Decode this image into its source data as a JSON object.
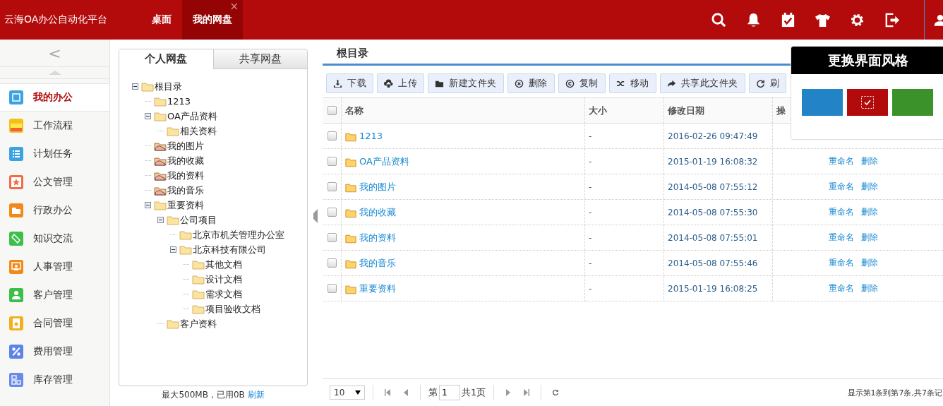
{
  "header": {
    "title": "云海OA办公自动化平台",
    "tabs": [
      {
        "label": "桌面",
        "selected": false
      },
      {
        "label": "我的网盘",
        "selected": true,
        "close": "×"
      }
    ]
  },
  "sidebar": {
    "collapse": "<",
    "items": [
      {
        "label": "我的办公",
        "selected": true,
        "color": "#3aa3e3"
      },
      {
        "label": "工作流程",
        "selected": false,
        "color": "#f2c21a"
      },
      {
        "label": "计划任务",
        "selected": false,
        "color": "#3aa3e3"
      },
      {
        "label": "公文管理",
        "selected": false,
        "color": "#f26b4a"
      },
      {
        "label": "行政办公",
        "selected": false,
        "color": "#f28a1a"
      },
      {
        "label": "知识交流",
        "selected": false,
        "color": "#3cbf4a"
      },
      {
        "label": "人事管理",
        "selected": false,
        "color": "#f28a1a"
      },
      {
        "label": "客户管理",
        "selected": false,
        "color": "#3cbf4a"
      },
      {
        "label": "合同管理",
        "selected": false,
        "color": "#f2b01a"
      },
      {
        "label": "费用管理",
        "selected": false,
        "color": "#5b84e8"
      },
      {
        "label": "库存管理",
        "selected": false,
        "color": "#6a8ae8"
      }
    ]
  },
  "disk_tabs": [
    {
      "label": "个人网盘",
      "selected": true
    },
    {
      "label": "共享网盘",
      "selected": false
    }
  ],
  "tree": [
    {
      "label": "根目录",
      "kind": "folder",
      "expanded": true,
      "children": [
        {
          "label": "1213",
          "kind": "folder"
        },
        {
          "label": "OA产品资料",
          "kind": "folder",
          "expanded": true,
          "children": [
            {
              "label": "相关资料",
              "kind": "folder"
            }
          ]
        },
        {
          "label": "我的图片",
          "kind": "shared"
        },
        {
          "label": "我的收藏",
          "kind": "shared"
        },
        {
          "label": "我的资料",
          "kind": "shared"
        },
        {
          "label": "我的音乐",
          "kind": "shared"
        },
        {
          "label": "重要资料",
          "kind": "folder",
          "expanded": true,
          "children": [
            {
              "label": "公司项目",
              "kind": "folder",
              "expanded": true,
              "children": [
                {
                  "label": "北京市机关管理办公室",
                  "kind": "folder"
                },
                {
                  "label": "北京科技有限公司",
                  "kind": "folder",
                  "expanded": true,
                  "children": [
                    {
                      "label": "其他文档",
                      "kind": "folder"
                    },
                    {
                      "label": "设计文档",
                      "kind": "folder"
                    },
                    {
                      "label": "需求文档",
                      "kind": "folder"
                    },
                    {
                      "label": "项目验收文档",
                      "kind": "folder"
                    }
                  ]
                }
              ]
            },
            {
              "label": "客户资料",
              "kind": "folder"
            }
          ]
        }
      ]
    }
  ],
  "quota": {
    "text": "最大500MB，已用0B",
    "link": "刷新"
  },
  "breadcrumb": "根目录",
  "toolbar": [
    "下载",
    "上传",
    "新建文件夹",
    "删除",
    "复制",
    "移动",
    "共享此文件夹",
    "刷"
  ],
  "table": {
    "select_all_checked": false,
    "columns": [
      "名称",
      "大小",
      "修改日期",
      "操"
    ],
    "rows": [
      {
        "name": "1213",
        "size": "-",
        "modified": "2016-02-26 09:47:49",
        "checked": false,
        "actions": []
      },
      {
        "name": "OA产品资料",
        "size": "-",
        "modified": "2015-01-19 16:08:32",
        "checked": false,
        "actions": [
          "重命名",
          "删除"
        ]
      },
      {
        "name": "我的图片",
        "size": "-",
        "modified": "2014-05-08 07:55:12",
        "checked": false,
        "actions": [
          "重命名",
          "删除"
        ]
      },
      {
        "name": "我的收藏",
        "size": "-",
        "modified": "2014-05-08 07:55:30",
        "checked": false,
        "actions": [
          "重命名",
          "删除"
        ]
      },
      {
        "name": "我的资料",
        "size": "-",
        "modified": "2014-05-08 07:55:01",
        "checked": false,
        "actions": [
          "重命名",
          "删除"
        ]
      },
      {
        "name": "我的音乐",
        "size": "-",
        "modified": "2014-05-08 07:55:46",
        "checked": false,
        "actions": [
          "重命名",
          "删除"
        ]
      },
      {
        "name": "重要资料",
        "size": "-",
        "modified": "2015-01-19 16:08:25",
        "checked": false,
        "actions": [
          "重命名",
          "删除"
        ]
      }
    ]
  },
  "pagination": {
    "page_size": "10",
    "page_prefix": "第",
    "page": "1",
    "page_suffix": "共1页",
    "summary": "显示第1条到第7条,共7条记"
  },
  "theme_popup": {
    "title": "更换界面风格",
    "swatches": [
      {
        "color": "#2283c6",
        "selected": false
      },
      {
        "color": "#b30b0b",
        "selected": true
      },
      {
        "color": "#3b922b",
        "selected": false
      }
    ]
  }
}
